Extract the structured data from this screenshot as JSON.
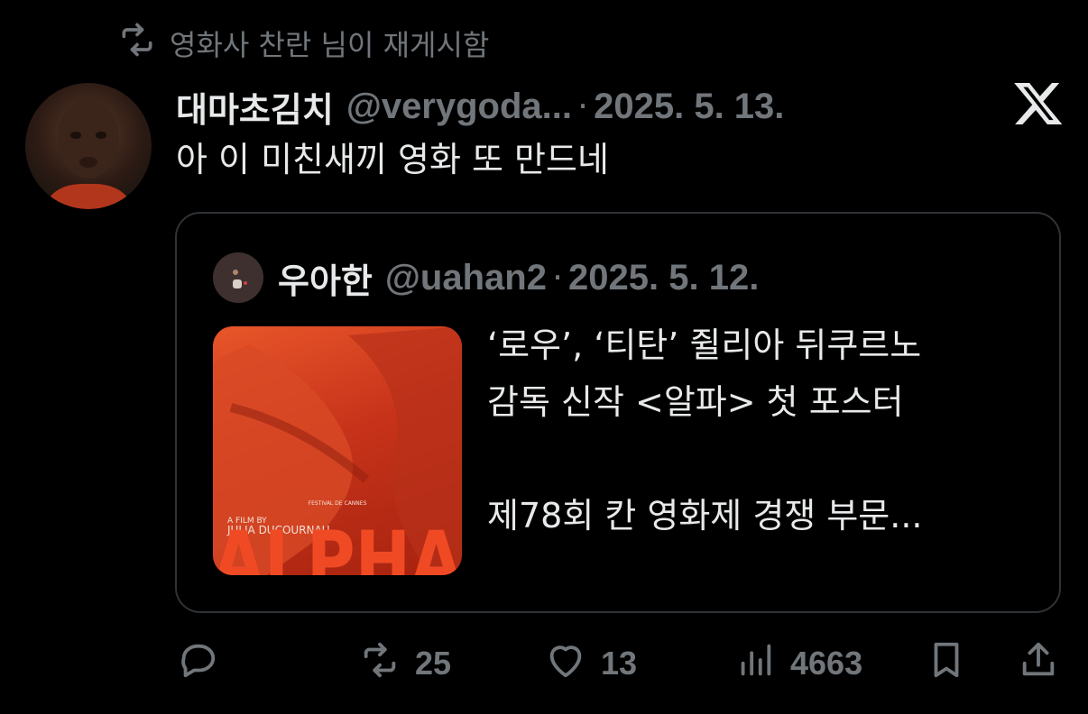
{
  "repost_context": {
    "label": "영화사 찬란 님이 재게시함",
    "icon": "repost-icon"
  },
  "tweet": {
    "author_name": "대마초김치",
    "author_handle": "@verygoda...",
    "separator": "·",
    "date": "2025. 5. 13.",
    "text": "아 이 미친새끼 영화 또 만드네",
    "source_logo": "x-logo"
  },
  "quoted_tweet": {
    "author_name": "우아한",
    "author_handle": "@uahan2",
    "separator": "·",
    "date": "2025. 5. 12.",
    "text": "‘로우’, ‘티탄’ 쥘리아 뒤쿠르노\n감독 신작 <알파> 첫 포스터\n\n제78회 칸 영화제 경쟁 부문...",
    "poster": {
      "credit_line1": "A FILM BY",
      "credit_line2": "JULIA DUCOURNAU",
      "festival": "FESTIVAL DE CANNES",
      "title": "ALPHA"
    }
  },
  "actions": {
    "reply": {
      "icon": "reply-icon",
      "count": ""
    },
    "repost": {
      "icon": "repost-icon",
      "count": "25"
    },
    "like": {
      "icon": "heart-icon",
      "count": "13"
    },
    "views": {
      "icon": "views-icon",
      "count": "4663"
    },
    "bookmark": {
      "icon": "bookmark-icon"
    },
    "share": {
      "icon": "share-icon"
    }
  },
  "colors": {
    "background": "#000000",
    "text": "#e7e9ea",
    "muted": "#71767b",
    "border": "#2f3336"
  }
}
